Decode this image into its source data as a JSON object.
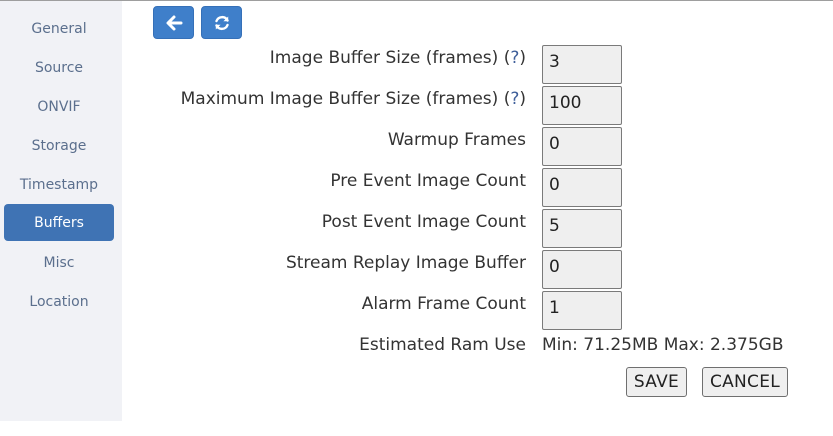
{
  "sidebar": {
    "items": [
      {
        "label": "General"
      },
      {
        "label": "Source"
      },
      {
        "label": "ONVIF"
      },
      {
        "label": "Storage"
      },
      {
        "label": "Timestamp"
      },
      {
        "label": "Buffers",
        "active": true
      },
      {
        "label": "Misc"
      },
      {
        "label": "Location"
      }
    ]
  },
  "toolbar": {
    "back_icon": "arrow-left-icon",
    "refresh_icon": "refresh-icon",
    "accent_color": "#3f7fca"
  },
  "form": {
    "rows": [
      {
        "label": "Image Buffer Size (frames)",
        "help": "?",
        "value": "3"
      },
      {
        "label": "Maximum Image Buffer Size (frames)",
        "help": "?",
        "value": "100"
      },
      {
        "label": "Warmup Frames",
        "value": "0"
      },
      {
        "label": "Pre Event Image Count",
        "value": "0"
      },
      {
        "label": "Post Event Image Count",
        "value": "5"
      },
      {
        "label": "Stream Replay Image Buffer",
        "value": "0"
      },
      {
        "label": "Alarm Frame Count",
        "value": "1"
      }
    ],
    "ram": {
      "label": "Estimated Ram Use",
      "value": "Min: 71.25MB Max: 2.375GB"
    }
  },
  "actions": {
    "save_label": "SAVE",
    "cancel_label": "CANCEL"
  }
}
